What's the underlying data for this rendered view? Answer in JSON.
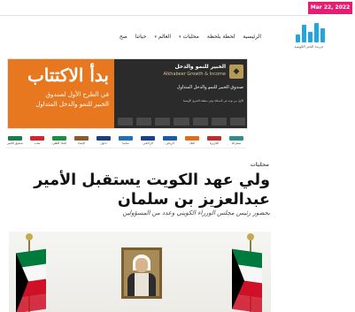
{
  "topbar": {
    "date": "Mar 22, 2022"
  },
  "logo": {
    "caption": "جريدة الخبر الكويتية"
  },
  "nav": {
    "items": [
      {
        "label": "الرئيسية",
        "has_dropdown": false
      },
      {
        "label": "لحظة بلحظة",
        "has_dropdown": false
      },
      {
        "label": "محليات",
        "has_dropdown": true
      },
      {
        "label": "العالم",
        "has_dropdown": true
      },
      {
        "label": "حياتنا",
        "has_dropdown": false
      },
      {
        "label": "صح",
        "has_dropdown": false
      }
    ]
  },
  "banner": {
    "headline": "بدأ الاكتتاب",
    "sub_line1": "في الطرح الأول لصندوق",
    "sub_line2": "الخبير للنمو والدخل المتداول",
    "fund_name_ar": "الخبير للنمو والدخل",
    "fund_name_en": "Alkhabeer Growth & Income",
    "description": "صندوق الخبير للنمو والدخل المتداول",
    "description_small": "الأول من نوعه في المملكة وفي منطقة الشرق الأوسط"
  },
  "partners": [
    "صندوق الخبير",
    "ساب",
    "البنك الأهلي",
    "الإنماء",
    "تداول",
    "سامبا",
    "الراجحي",
    "الرياض",
    "البلاد",
    "الجزيرة",
    "مشاركة"
  ],
  "article": {
    "category": "محليات",
    "title": "ولي عهد الكويت يستقبل الأمير عبدالعزيز بن سلمان",
    "subtitle": "بحضور رئيس مجلس الوزراء الكويتي وعدد من المسؤولين"
  },
  "colors": {
    "date_badge": "#e71d73",
    "logo_blue": "#23a6dd",
    "banner_orange": "#e8781f",
    "banner_dark": "#2b2b2b",
    "flag_green": "#007a3d",
    "flag_red": "#ce1126",
    "flag_black": "#000000"
  }
}
